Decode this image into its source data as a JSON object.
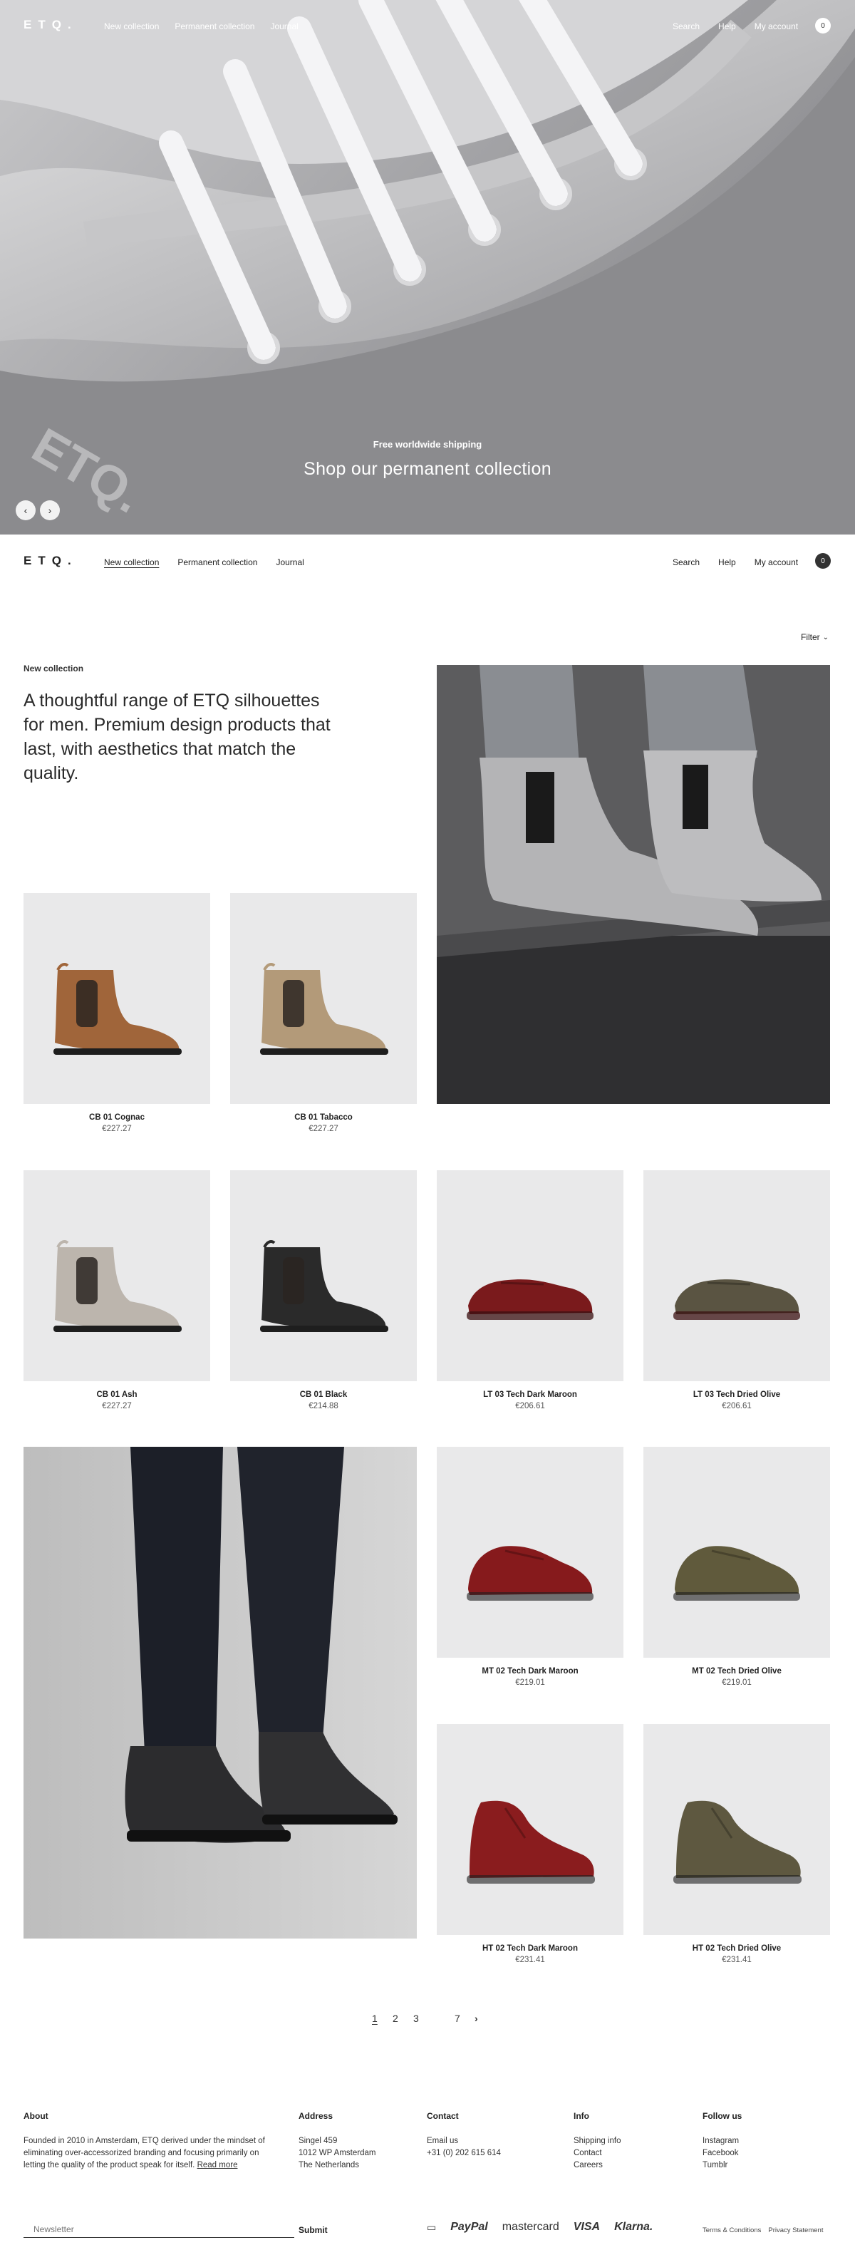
{
  "brand": {
    "logo": "ETQ."
  },
  "hero_header": {
    "links": [
      "New collection",
      "Permanent collection",
      "Journal"
    ],
    "right_links": [
      "Search",
      "Help",
      "My account"
    ],
    "cart_count": "0"
  },
  "hero": {
    "shipping": "Free worldwide shipping",
    "cta": "Shop our permanent collection",
    "prev_icon": "arrow-left-icon",
    "next_icon": "arrow-right-icon"
  },
  "nav": {
    "links": [
      "New collection",
      "Permanent collection",
      "Journal"
    ],
    "right_links": [
      "Search",
      "Help",
      "My account"
    ],
    "cart_count": "0",
    "active": "New collection"
  },
  "filter": {
    "label": "Filter"
  },
  "collection": {
    "eyebrow": "New collection",
    "intro": "A thoughtful range of ETQ silhouettes for men. Premium design products that last, with aesthetics that match the quality."
  },
  "products": [
    {
      "name": "CB 01 Cognac",
      "price": "€227.27",
      "color": "#a0653a"
    },
    {
      "name": "CB 01 Tabacco",
      "price": "€227.27",
      "color": "#b39a79"
    },
    {
      "name": "CB 01 Ash",
      "price": "€227.27",
      "color": "#bcb5ad"
    },
    {
      "name": "CB 01 Black",
      "price": "€214.88",
      "color": "#2a2a2a"
    },
    {
      "name": "LT 03 Tech Dark Maroon",
      "price": "€206.61",
      "color": "#7a1a1c"
    },
    {
      "name": "LT 03 Tech Dried Olive",
      "price": "€206.61",
      "color": "#5a5442"
    },
    {
      "name": "MT 02 Tech Dark Maroon",
      "price": "€219.01",
      "color": "#861a1c"
    },
    {
      "name": "MT 02 Tech Dried Olive",
      "price": "€219.01",
      "color": "#605a3c"
    },
    {
      "name": "HT 02 Tech Dark Maroon",
      "price": "€231.41",
      "color": "#8a1c1e"
    },
    {
      "name": "HT 02 Tech Dried Olive",
      "price": "€231.41",
      "color": "#5e5840"
    }
  ],
  "pagination": {
    "pages": [
      "1",
      "2",
      "3",
      "7"
    ],
    "current": "1",
    "next_icon": "chevron-right-icon"
  },
  "footer": {
    "about": {
      "heading": "About",
      "text": "Founded in 2010 in Amsterdam, ETQ derived under the mindset of eliminating over-accessorized branding and focusing primarily on letting the quality of the product speak for itself.",
      "read_more": "Read more"
    },
    "address": {
      "heading": "Address",
      "lines": [
        "Singel 459",
        "1012 WP Amsterdam",
        "The Netherlands"
      ]
    },
    "contact": {
      "heading": "Contact",
      "lines": [
        "Email us",
        "+31 (0) 202 615 614"
      ]
    },
    "info": {
      "heading": "Info",
      "links": [
        "Shipping info",
        "Contact",
        "Careers"
      ]
    },
    "follow": {
      "heading": "Follow us",
      "links": [
        "Instagram",
        "Facebook",
        "Tumblr"
      ]
    },
    "newsletter": {
      "placeholder": "Newsletter",
      "submit": "Submit"
    },
    "payments": [
      "PayPal",
      "mastercard",
      "VISA",
      "Klarna."
    ],
    "legal": [
      "Terms & Conditions",
      "Privacy Statement"
    ]
  }
}
